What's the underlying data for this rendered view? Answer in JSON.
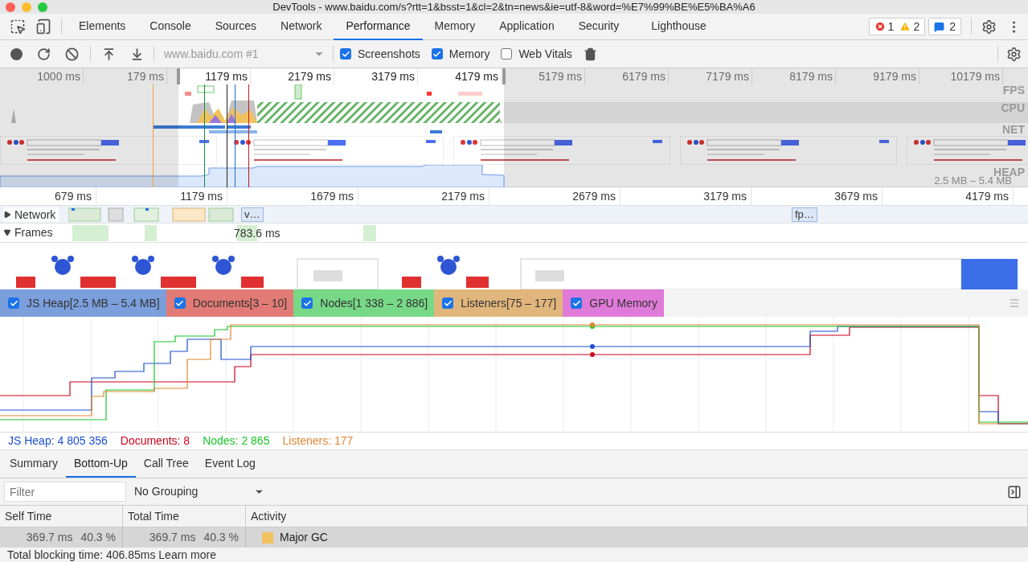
{
  "window": {
    "title": "DevTools - www.baidu.com/s?rtt=1&bsst=1&cl=2&tn=news&ie=utf-8&word=%E7%99%BE%E5%BA%A6"
  },
  "tabs": [
    {
      "label": "Elements",
      "selected": false
    },
    {
      "label": "Console",
      "selected": false
    },
    {
      "label": "Sources",
      "selected": false
    },
    {
      "label": "Network",
      "selected": false
    },
    {
      "label": "Performance",
      "selected": true
    },
    {
      "label": "Memory",
      "selected": false
    },
    {
      "label": "Application",
      "selected": false
    },
    {
      "label": "Security",
      "selected": false
    },
    {
      "label": "Lighthouse",
      "selected": false
    }
  ],
  "issues": {
    "errors": "1",
    "warnings": "2",
    "messages": "2"
  },
  "toolbar": {
    "target": "www.baidu.com #1",
    "options": [
      {
        "label": "Screenshots",
        "checked": true
      },
      {
        "label": "Memory",
        "checked": true
      },
      {
        "label": "Web Vitals",
        "checked": false
      }
    ]
  },
  "overview": {
    "ruler": [
      {
        "label": "1000 ms",
        "in_selection": false
      },
      {
        "label": "179 ms",
        "in_selection": false
      },
      {
        "label": "1179 ms",
        "in_selection": true
      },
      {
        "label": "2179 ms",
        "in_selection": true
      },
      {
        "label": "3179 ms",
        "in_selection": true
      },
      {
        "label": "4179 ms",
        "in_selection": true
      },
      {
        "label": "5179 ms",
        "in_selection": false
      },
      {
        "label": "6179 ms",
        "in_selection": false
      },
      {
        "label": "7179 ms",
        "in_selection": false
      },
      {
        "label": "8179 ms",
        "in_selection": false
      },
      {
        "label": "9179 ms",
        "in_selection": false
      },
      {
        "label": "10179 ms",
        "in_selection": false
      }
    ],
    "track_labels": [
      "FPS",
      "CPU",
      "NET",
      "HEAP"
    ],
    "heap_range": "2.5 MB – 5.4 MB"
  },
  "timeline": {
    "ruler": [
      "679 ms",
      "1179 ms",
      "1679 ms",
      "2179 ms",
      "2679 ms",
      "3179 ms",
      "3679 ms",
      "4179 ms"
    ],
    "tracks": [
      {
        "kind": "network",
        "name": "Network",
        "expanded": false,
        "items": [
          "v…",
          "fp…"
        ]
      },
      {
        "kind": "frames",
        "name": "Frames",
        "expanded": true,
        "items": [
          "783.6 ms"
        ]
      }
    ]
  },
  "memory": {
    "counters": [
      {
        "label": "JS Heap[2.5 MB – 5.4 MB]",
        "checked": true,
        "color": "#7b9fdc"
      },
      {
        "label": "Documents[3 – 10]",
        "checked": true,
        "color": "#e27b76"
      },
      {
        "label": "Nodes[1 338 – 2 886]",
        "checked": true,
        "color": "#77d987"
      },
      {
        "label": "Listeners[75 – 177]",
        "checked": true,
        "color": "#e1b67c"
      },
      {
        "label": "GPU Memory",
        "checked": true,
        "color": "#e07ad9"
      }
    ],
    "readings": [
      {
        "text": "JS Heap: 4 805 356",
        "color": "#1a4fd0"
      },
      {
        "text": "Documents: 8",
        "color": "#d0021b"
      },
      {
        "text": "Nodes: 2 865",
        "color": "#19c52a"
      },
      {
        "text": "Listeners: 177",
        "color": "#e08533"
      }
    ]
  },
  "details": {
    "tabs": [
      {
        "label": "Summary",
        "selected": false
      },
      {
        "label": "Bottom-Up",
        "selected": true
      },
      {
        "label": "Call Tree",
        "selected": false
      },
      {
        "label": "Event Log",
        "selected": false
      }
    ],
    "filter": {
      "placeholder": "Filter"
    },
    "grouping": "No Grouping",
    "columns": [
      "Self Time",
      "Total Time",
      "Activity"
    ],
    "rows": [
      {
        "self_time": "369.7 ms",
        "self_percent": "40.3 %",
        "total_time": "369.7 ms",
        "total_percent": "40.3 %",
        "activity": "Major GC",
        "color": "#f2c15f",
        "selected": true
      }
    ],
    "footer": {
      "text": "Total blocking time: 406.85ms",
      "link": "Learn more"
    }
  }
}
